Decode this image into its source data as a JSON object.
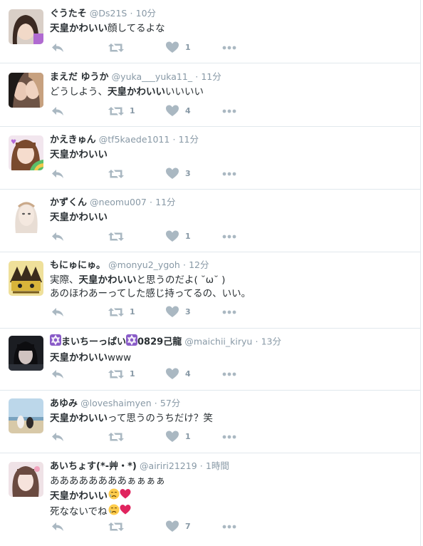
{
  "tweets": [
    {
      "fullname": "ぐうたそ",
      "username": "@Ds21S",
      "sep": "·",
      "time": "10分",
      "lines": [
        [
          "天皇かわいい",
          "顔してるよな"
        ]
      ],
      "retweets": "",
      "likes": "1",
      "avatar": "avatar-1"
    },
    {
      "fullname": "まえだ ゆうか",
      "username": "@yuka___yuka11_",
      "sep": "·",
      "time": "11分",
      "lines": [
        [
          "どうしよう、",
          "天皇かわいい",
          "いいいい"
        ]
      ],
      "retweets": "1",
      "likes": "4",
      "avatar": "avatar-2"
    },
    {
      "fullname": "かえきゅん",
      "username": "@tf5kaede1011",
      "sep": "·",
      "time": "11分",
      "lines": [
        [
          "天皇かわいい"
        ]
      ],
      "retweets": "",
      "likes": "3",
      "avatar": "avatar-3"
    },
    {
      "fullname": "かずくん",
      "username": "@neomu007",
      "sep": "·",
      "time": "11分",
      "lines": [
        [
          "天皇かわいい"
        ]
      ],
      "retweets": "",
      "likes": "1",
      "avatar": "avatar-4"
    },
    {
      "fullname": "もにゅにゅ。",
      "username": "@monyu2_ygoh",
      "sep": "·",
      "time": "12分",
      "lines": [
        [
          "実際、",
          "天皇かわいい",
          "と思うのだよ( ˘ω˘ )"
        ],
        [
          "あのほわあーってした感じ持ってるの、いい。"
        ]
      ],
      "retweets": "1",
      "likes": "3",
      "avatar": "avatar-5"
    },
    {
      "fullname_prefix_emoji": "star-of-david-emoji",
      "fullname": "まいちーっぱい",
      "fullname_mid_emoji": "star-of-david-emoji",
      "fullname_suffix": "0829己龍",
      "username": "@maichii_kiryu",
      "sep": "·",
      "time": "13分",
      "lines": [
        [
          "天皇かわいい",
          "www"
        ]
      ],
      "retweets": "1",
      "likes": "4",
      "avatar": "avatar-6"
    },
    {
      "fullname": "あゆみ",
      "username": "@loveshaimyen",
      "sep": "·",
      "time": "57分",
      "lines": [
        [
          "天皇かわいい",
          "って思うのうちだけ？笑"
        ]
      ],
      "retweets": "",
      "likes": "1",
      "avatar": "avatar-7"
    },
    {
      "fullname": "あいちょす(*-艸・*)",
      "username": "@airiri21219",
      "sep": "·",
      "time": "1時間",
      "lines": [
        [
          "ああああああああぁぁぁぁ"
        ],
        [
          "天皇かわいい"
        ],
        [
          "死なないでね"
        ]
      ],
      "line_emojis": [
        "",
        "crying-face-emoji heart-emoji",
        "crying-face-emoji heart-emoji"
      ],
      "retweets": "",
      "likes": "7",
      "avatar": "avatar-8"
    }
  ],
  "icons": {
    "reply": "reply-icon",
    "retweet": "retweet-icon",
    "like": "heart-icon",
    "more": "more-icon"
  },
  "colors": {
    "icon": "#aab8c2",
    "meta": "#8899a6",
    "text": "#292f33",
    "border": "#e1e8ed",
    "heart_emoji": "#e0245e"
  }
}
